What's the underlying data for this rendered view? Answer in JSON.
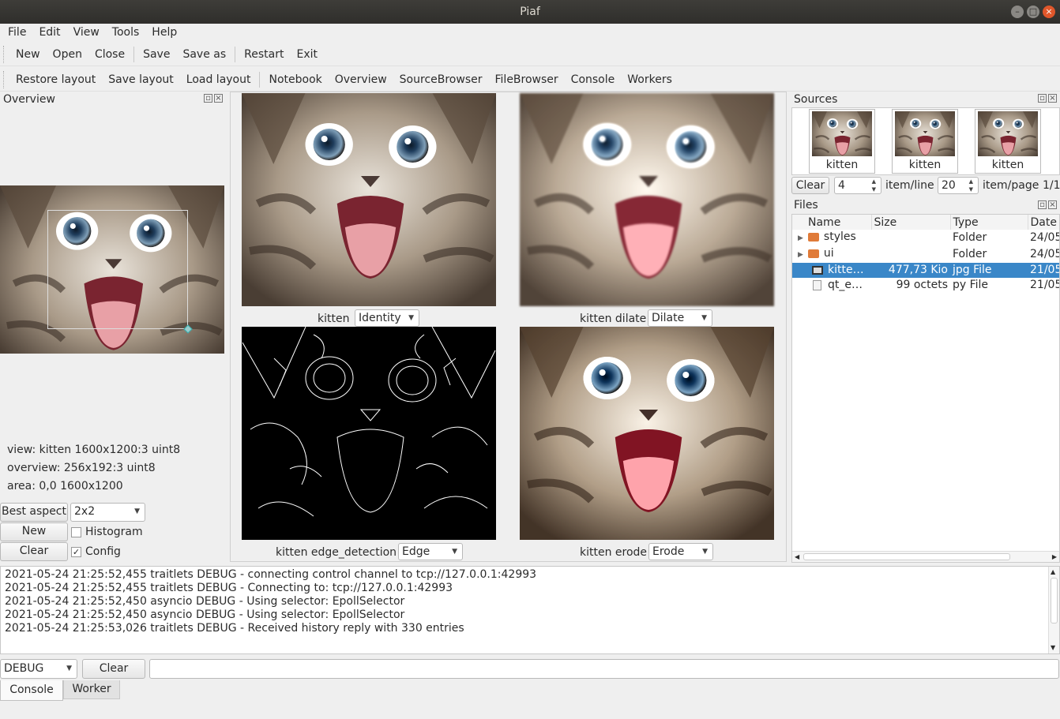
{
  "window": {
    "title": "Piaf"
  },
  "menu": [
    "File",
    "Edit",
    "View",
    "Tools",
    "Help"
  ],
  "toolbar1": [
    "New",
    "Open",
    "Close",
    "Save",
    "Save as",
    "Restart",
    "Exit"
  ],
  "toolbar2": {
    "layout": [
      "Restore layout",
      "Save layout",
      "Load layout"
    ],
    "docks": [
      "Notebook",
      "Overview",
      "SourceBrowser",
      "FileBrowser",
      "Console",
      "Workers"
    ]
  },
  "overview": {
    "title": "Overview",
    "info": [
      "view: kitten 1600x1200:3 uint8",
      "overview: 256x192:3 uint8",
      "area: 0,0 1600x1200"
    ],
    "best_aspect": "Best aspect",
    "layout_value": "2x2",
    "new_label": "New",
    "clear_label": "Clear",
    "histogram_label": "Histogram",
    "histogram_checked": false,
    "config_label": "Config",
    "config_checked": true
  },
  "views": [
    {
      "name": "kitten",
      "filter": "Identity"
    },
    {
      "name": "kitten dilate",
      "filter": "Dilate"
    },
    {
      "name": "kitten edge_detection",
      "filter": "Edge"
    },
    {
      "name": "kitten erode",
      "filter": "Erode"
    }
  ],
  "sources": {
    "title": "Sources",
    "thumbs": [
      "kitten",
      "kitten",
      "kitten"
    ],
    "clear_label": "Clear",
    "items_per_line": "4",
    "items_per_line_label": "item/line",
    "items_per_page": "20",
    "items_per_page_label": "item/page",
    "page": "1/1"
  },
  "files": {
    "title": "Files",
    "columns": [
      "Name",
      "Size",
      "Type",
      "Date"
    ],
    "rows": [
      {
        "name": "styles",
        "size": "",
        "type": "Folder",
        "date": "24/05",
        "kind": "folder",
        "expandable": true,
        "selected": false
      },
      {
        "name": "ui",
        "size": "",
        "type": "Folder",
        "date": "24/05",
        "kind": "folder",
        "expandable": true,
        "selected": false
      },
      {
        "name": "kitte…",
        "size": "477,73 Kio",
        "type": "jpg File",
        "date": "21/05",
        "kind": "image",
        "expandable": false,
        "selected": true
      },
      {
        "name": "qt_e…",
        "size": "99 octets",
        "type": "py File",
        "date": "21/05",
        "kind": "file",
        "expandable": false,
        "selected": false
      }
    ]
  },
  "console": {
    "lines": [
      "2021-05-24 21:25:52,455 traitlets DEBUG - connecting control channel to tcp://127.0.0.1:42993",
      "2021-05-24 21:25:52,455 traitlets DEBUG - Connecting to: tcp://127.0.0.1:42993",
      "2021-05-24 21:25:52,450 asyncio DEBUG - Using selector: EpollSelector",
      "2021-05-24 21:25:52,450 asyncio DEBUG - Using selector: EpollSelector",
      "2021-05-24 21:25:53,026 traitlets DEBUG - Received history reply with 330 entries"
    ],
    "level": "DEBUG",
    "clear_label": "Clear",
    "input_value": ""
  },
  "bottom_tabs": [
    {
      "label": "Console",
      "active": true
    },
    {
      "label": "Worker",
      "active": false
    }
  ],
  "colors": {
    "selection": "#3a87c8",
    "titlebar": "#3e3d39"
  }
}
